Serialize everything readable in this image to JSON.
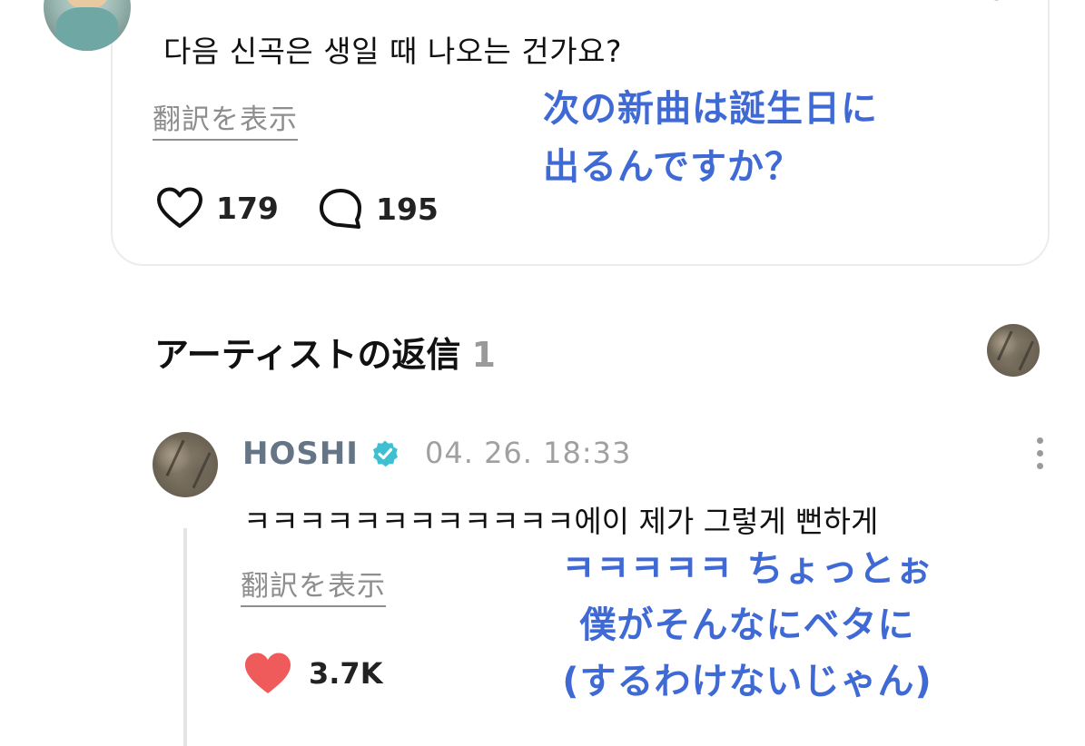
{
  "post": {
    "text": "다음 신곡은 생일 때 나오는 건가요?",
    "translate_label": "翻訳を表示",
    "likes": "179",
    "comments": "195"
  },
  "overlay_top": {
    "line1": "次の新曲は誕生日に",
    "line2": "出るんですか？"
  },
  "artist_replies": {
    "heading": "アーティストの返信",
    "count": "1"
  },
  "reply": {
    "author": "HOSHI",
    "timestamp": "04. 26. 18:33",
    "text": "ㅋㅋㅋㅋㅋㅋㅋㅋㅋㅋㅋㅋ에이 제가 그렇게 뻔하게",
    "translate_label": "翻訳を表示",
    "likes": "3.7K"
  },
  "overlay_bottom": {
    "line1": "ㅋㅋㅋㅋㅋ ちょっとぉ",
    "line2": "僕がそんなにベタに",
    "line3": "(するわけないじゃん)"
  },
  "icons": {
    "heart_outline": "heart-icon",
    "comment": "comment-bubble-icon",
    "heart_filled": "heart-filled-icon",
    "verified": "verified-badge-icon",
    "more": "more-vertical-icon"
  },
  "colors": {
    "overlay_blue": "#3f69d4",
    "liked_red": "#ef5a5a",
    "verified_teal": "#3fbfd0",
    "author_gray": "#667585"
  }
}
